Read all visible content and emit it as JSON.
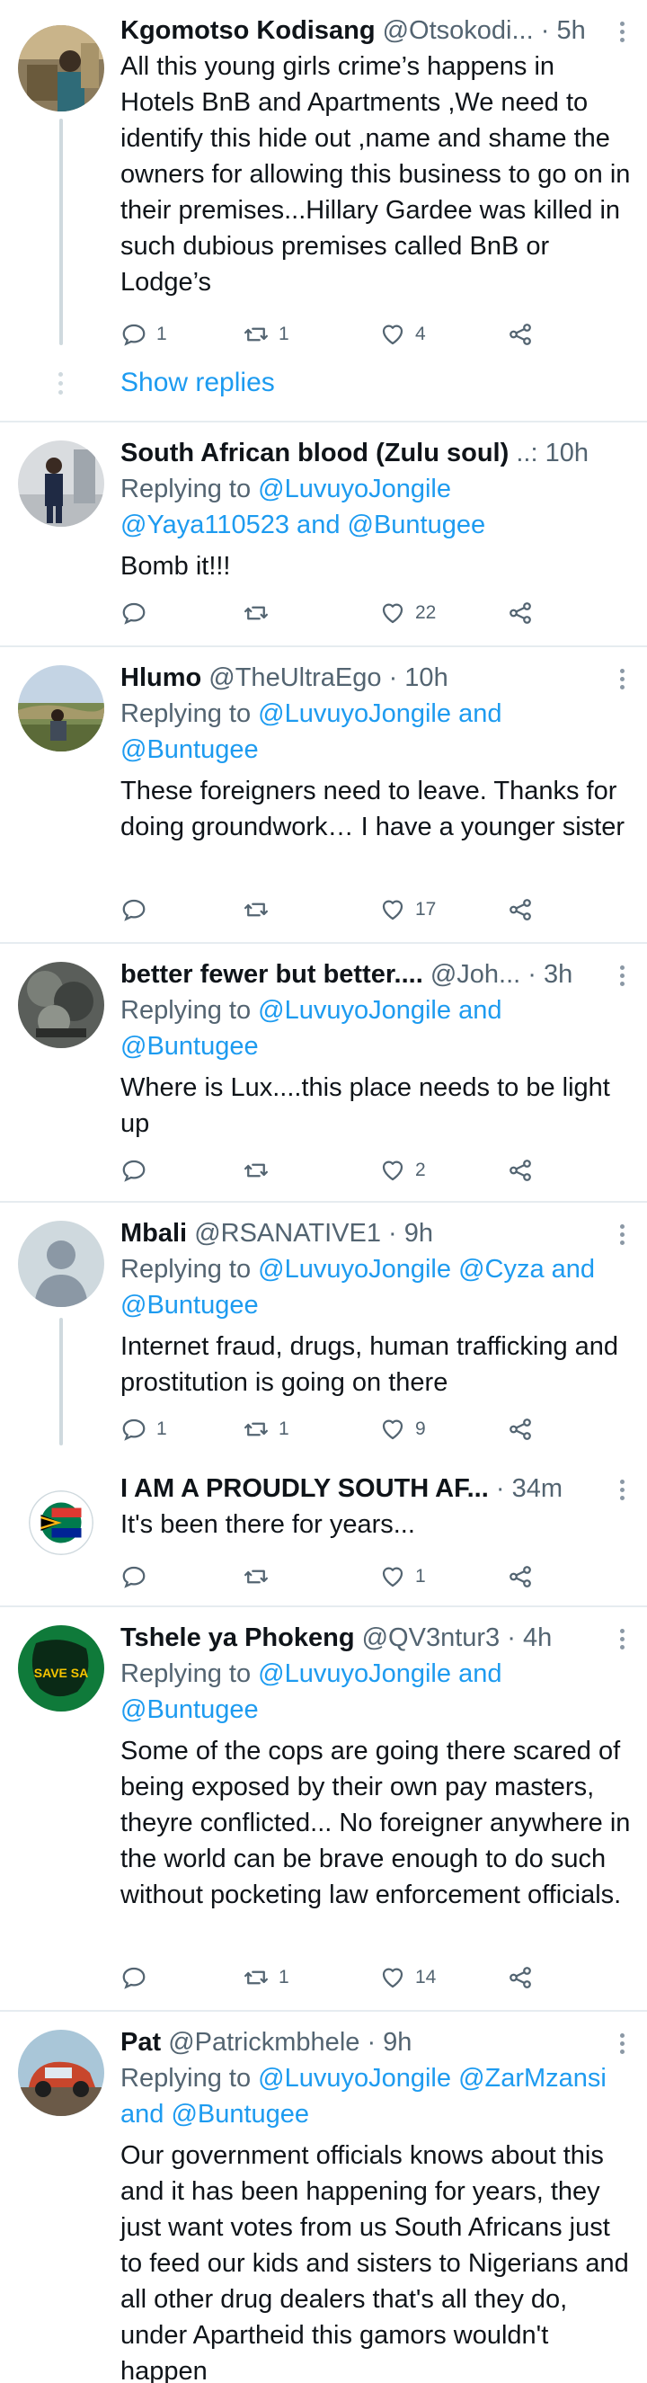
{
  "tweets": [
    {
      "name": "Kgomotso Kodisang",
      "handle": "@Otsokodi...",
      "time": " · 5h",
      "body": "All this young girls crime’s happens in Hotels BnB and Apartments ,We need to identify this hide out ,name and shame the owners for allowing this business to go on in their premises...Hillary Gardee was killed in such dubious premises called BnB or Lodge’s",
      "replies": "1",
      "retweets": "1",
      "likes": "4",
      "show_replies": "Show replies"
    },
    {
      "name": "South African blood (Zulu soul)",
      "handle": "..:",
      "time": " 10h",
      "replying_prefix": "Replying to ",
      "replying_line1": "@LuvuyoJongile",
      "replying_line2": "@Yaya110523 and @Buntugee",
      "body": "Bomb it!!!",
      "replies": "",
      "retweets": "",
      "likes": "22"
    },
    {
      "name": "Hlumo",
      "handle": "@TheUltraEgo",
      "time": " · 10h",
      "replying_prefix": "Replying to ",
      "replying_line1": "@LuvuyoJongile and",
      "replying_line2": "@Buntugee",
      "body": "These foreigners need to leave. Thanks for doing groundwork… I have a younger sister",
      "replies": "",
      "retweets": "",
      "likes": "17"
    },
    {
      "name": "better fewer but better....",
      "handle": "@Joh...",
      "time": " · 3h",
      "replying_prefix": "Replying to ",
      "replying_line1": "@LuvuyoJongile and",
      "replying_line2": "@Buntugee",
      "body": "Where is Lux....this place needs to be light up",
      "replies": "",
      "retweets": "",
      "likes": "2"
    },
    {
      "name": "Mbali",
      "handle": "@RSANATIVE1",
      "time": " · 9h",
      "replying_prefix": "Replying to ",
      "replying_line1": "@LuvuyoJongile @Cyza and",
      "replying_line2": "@Buntugee",
      "body": "Internet fraud, drugs, human trafficking and prostitution is going on there",
      "replies": "1",
      "retweets": "1",
      "likes": "9"
    },
    {
      "name": "I AM A PROUDLY SOUTH AF...",
      "handle": "",
      "time": " · 34m",
      "body": "It's been there for years...",
      "replies": "",
      "retweets": "",
      "likes": "1"
    },
    {
      "name": "Tshele ya Phokeng",
      "handle": "@QV3ntur3",
      "time": " · 4h",
      "replying_prefix": "Replying to ",
      "replying_line1": "@LuvuyoJongile and",
      "replying_line2": "@Buntugee",
      "body": "Some of the cops are going there scared of being exposed by their own pay masters, theyre conflicted... No foreigner anywhere in the world can be brave enough to do such without pocketing law enforcement officials.",
      "replies": "",
      "retweets": "1",
      "likes": "14",
      "avatar_text": "SAVE SA"
    },
    {
      "name": "Pat",
      "handle": "@Patrickmbhele",
      "time": " · 9h",
      "replying_prefix": "Replying to ",
      "replying_line1": "@LuvuyoJongile @ZarMzansi",
      "replying_line2": "and @Buntugee",
      "body": "Our government officials knows about this and it has been happening for years, they just want votes from us South Africans just to feed our kids and sisters to Nigerians and all other drug dealers that's all they do, under Apartheid this gamors wouldn't  happen"
    }
  ],
  "colors": {
    "link": "#1d9bf0",
    "muted": "#536471",
    "separator": "#e6ecf0",
    "thread": "#cfd9de"
  }
}
